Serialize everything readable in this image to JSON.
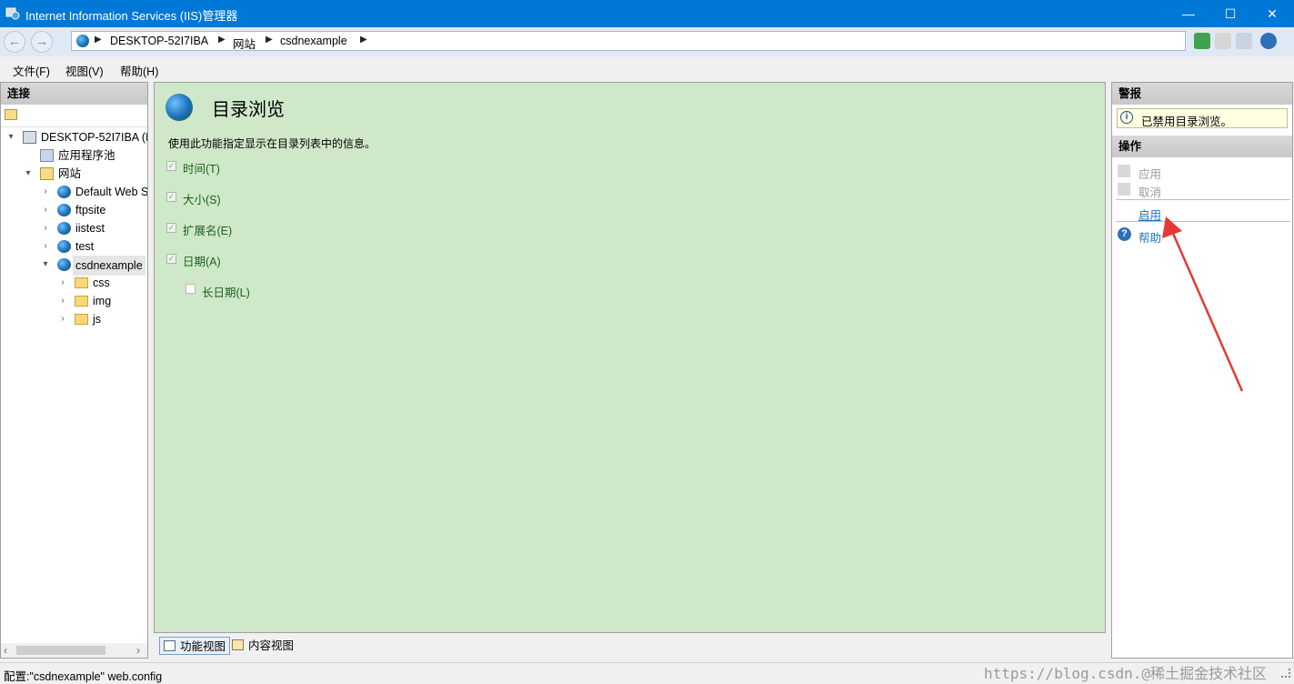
{
  "window": {
    "title": "Internet Information Services (IIS)管理器",
    "controls": {
      "minimize": "—",
      "maximize": "☐",
      "close": "✕"
    }
  },
  "address": {
    "back": "←",
    "forward": "→",
    "crumbs": [
      "DESKTOP-52I7IBA",
      "网站",
      "csdnexample"
    ],
    "arrow": "▶"
  },
  "menu": [
    "文件(F)",
    "视图(V)",
    "帮助(H)"
  ],
  "connections": {
    "title": "连接",
    "tree": [
      {
        "label": "DESKTOP-52I7IBA (D",
        "expander": "▾"
      },
      {
        "label": "应用程序池",
        "expander": ""
      },
      {
        "label": "网站",
        "expander": "▾"
      },
      {
        "label": "Default Web S",
        "expander": "›"
      },
      {
        "label": "ftpsite",
        "expander": "›"
      },
      {
        "label": "iistest",
        "expander": "›"
      },
      {
        "label": "test",
        "expander": "›"
      },
      {
        "label": "csdnexample",
        "expander": "▾"
      },
      {
        "label": "css",
        "expander": "›"
      },
      {
        "label": "img",
        "expander": "›"
      },
      {
        "label": "js",
        "expander": "›"
      }
    ],
    "scroll_left": "‹",
    "scroll_right": "›"
  },
  "feature": {
    "title": "目录浏览",
    "description": "使用此功能指定显示在目录列表中的信息。",
    "options": [
      {
        "label": "时间(T)",
        "checked": true
      },
      {
        "label": "大小(S)",
        "checked": true
      },
      {
        "label": "扩展名(E)",
        "checked": true
      },
      {
        "label": "日期(A)",
        "checked": true
      },
      {
        "label": "长日期(L)",
        "checked": false
      }
    ]
  },
  "view_tabs": [
    "功能视图",
    "内容视图"
  ],
  "alerts": {
    "title": "警报",
    "message": "已禁用目录浏览。",
    "info_glyph": "i"
  },
  "actions": {
    "title": "操作",
    "apply": "应用",
    "cancel": "取消",
    "enable": "启用",
    "help": "帮助",
    "help_glyph": "?"
  },
  "status": {
    "text": "配置:\"csdnexample\" web.config",
    "watermark": "https://blog.csdn.@稀土掘金技术社区"
  },
  "colors": {
    "titlebar": "#0078d7",
    "content_bg": "#cfe8c9",
    "annotation_arrow": "#e53935",
    "link": "#1e73be"
  }
}
